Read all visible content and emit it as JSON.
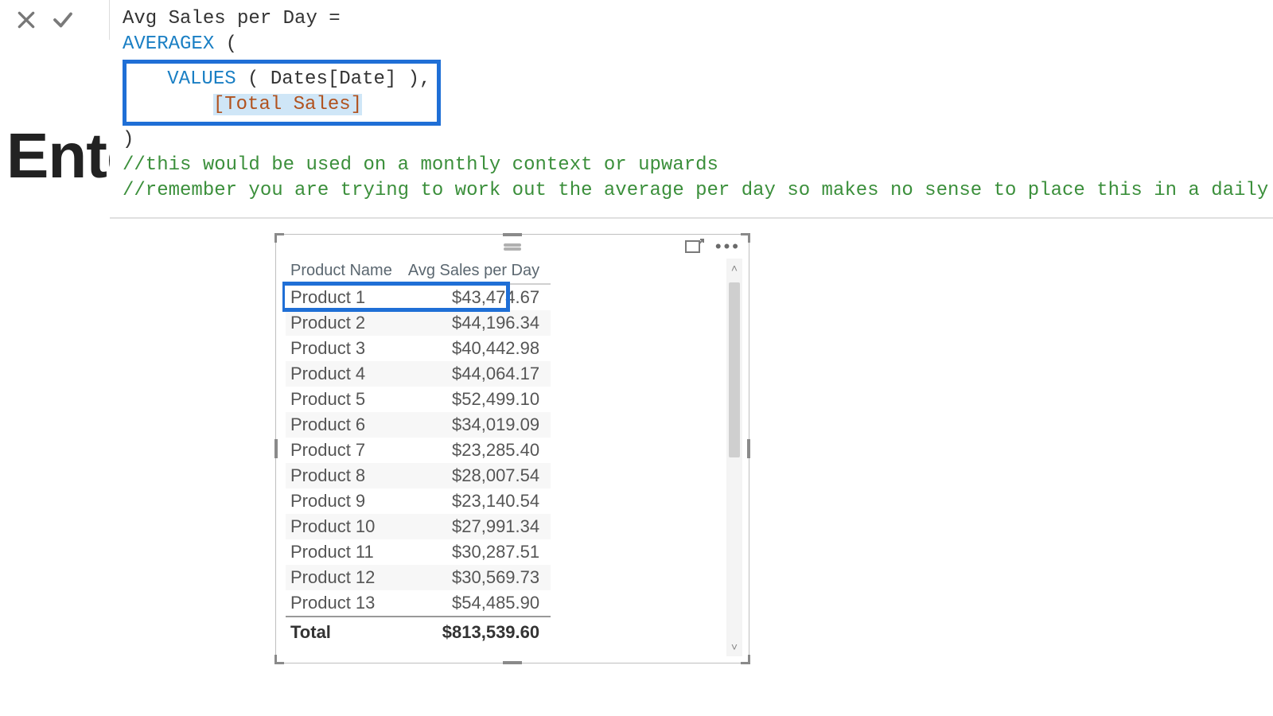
{
  "toolbar": {
    "cancel_label": "cancel",
    "commit_label": "commit"
  },
  "formula": {
    "measure_name": "Avg Sales per Day",
    "equals": " =",
    "func_averagex": "AVERAGEX",
    "open_paren": " (",
    "func_values": "VALUES",
    "values_arg": " ( Dates[Date] ),",
    "measure_ref": "[Total Sales]",
    "close_paren": ")",
    "comment1": "//this would be used on a monthly context or upwards",
    "comment2": "//remember you are trying to work out the average per day so makes no sense to place this in a daily context"
  },
  "background_text": "Ente",
  "table": {
    "headers": {
      "col1": "Product Name",
      "col2": "Avg Sales per Day"
    },
    "rows": [
      {
        "name": "Product 1",
        "value": "$43,474.67"
      },
      {
        "name": "Product 2",
        "value": "$44,196.34"
      },
      {
        "name": "Product 3",
        "value": "$40,442.98"
      },
      {
        "name": "Product 4",
        "value": "$44,064.17"
      },
      {
        "name": "Product 5",
        "value": "$52,499.10"
      },
      {
        "name": "Product 6",
        "value": "$34,019.09"
      },
      {
        "name": "Product 7",
        "value": "$23,285.40"
      },
      {
        "name": "Product 8",
        "value": "$28,007.54"
      },
      {
        "name": "Product 9",
        "value": "$23,140.54"
      },
      {
        "name": "Product 10",
        "value": "$27,991.34"
      },
      {
        "name": "Product 11",
        "value": "$30,287.51"
      },
      {
        "name": "Product 12",
        "value": "$30,569.73"
      },
      {
        "name": "Product 13",
        "value": "$54,485.90"
      }
    ],
    "total_label": "Total",
    "total_value": "$813,539.60"
  }
}
